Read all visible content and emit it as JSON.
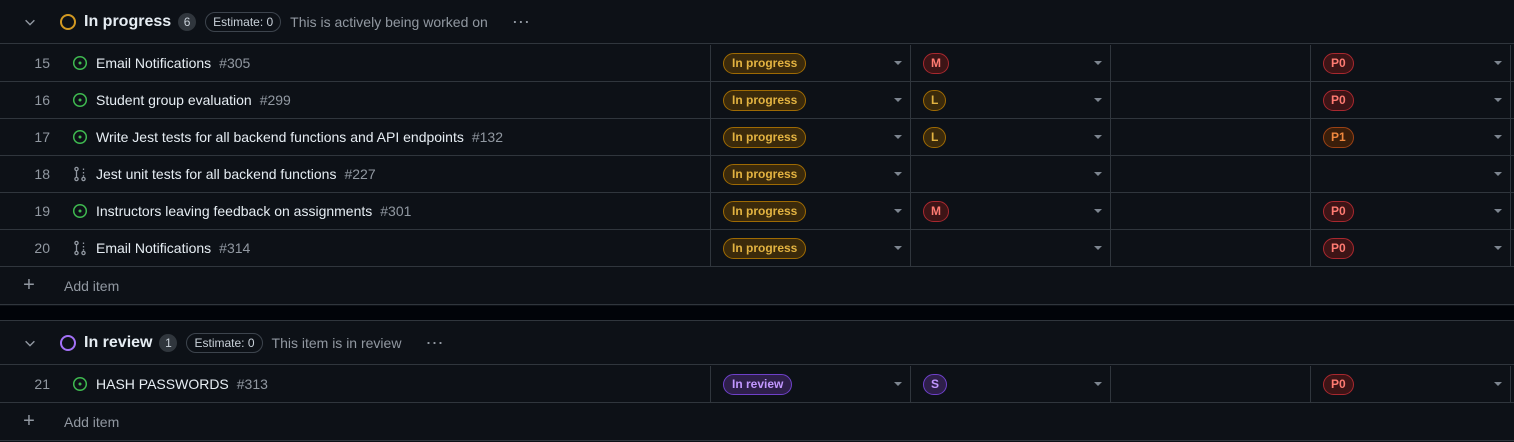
{
  "groups": [
    {
      "title": "In progress",
      "count": "6",
      "estimate": "Estimate: 0",
      "description": "This is actively being worked on",
      "ring_color": "#d29922",
      "add_label": "Add item",
      "items": [
        {
          "num": "15",
          "icon": "open-issue-icon",
          "title": "Email Notifications",
          "ref": "#305",
          "status": "In progress",
          "size": "M",
          "priority": "P0"
        },
        {
          "num": "16",
          "icon": "open-issue-icon",
          "title": "Student group evaluation",
          "ref": "#299",
          "status": "In progress",
          "size": "L",
          "priority": "P0"
        },
        {
          "num": "17",
          "icon": "open-issue-icon",
          "title": "Write Jest tests for all backend functions and API endpoints",
          "ref": "#132",
          "status": "In progress",
          "size": "L",
          "priority": "P1"
        },
        {
          "num": "18",
          "icon": "pull-request-icon",
          "title": "Jest unit tests for all backend functions",
          "ref": "#227",
          "status": "In progress",
          "size": "",
          "priority": ""
        },
        {
          "num": "19",
          "icon": "open-issue-icon",
          "title": "Instructors leaving feedback on assignments",
          "ref": "#301",
          "status": "In progress",
          "size": "M",
          "priority": "P0"
        },
        {
          "num": "20",
          "icon": "pull-request-icon",
          "title": "Email Notifications",
          "ref": "#314",
          "status": "In progress",
          "size": "",
          "priority": "P0"
        }
      ]
    },
    {
      "title": "In review",
      "count": "1",
      "estimate": "Estimate: 0",
      "description": "This item is in review",
      "ring_color": "#a371f7",
      "add_label": "Add item",
      "items": [
        {
          "num": "21",
          "icon": "open-issue-icon",
          "title": "HASH PASSWORDS",
          "ref": "#313",
          "status": "In review",
          "size": "S",
          "priority": "P0"
        }
      ]
    }
  ],
  "icons": {
    "more": "⋯",
    "plus": "+"
  },
  "colors": {
    "open_issue": "#3fb950",
    "pull_request": "#9198a1",
    "in_progress": "#d29922",
    "in_review": "#a371f7"
  }
}
